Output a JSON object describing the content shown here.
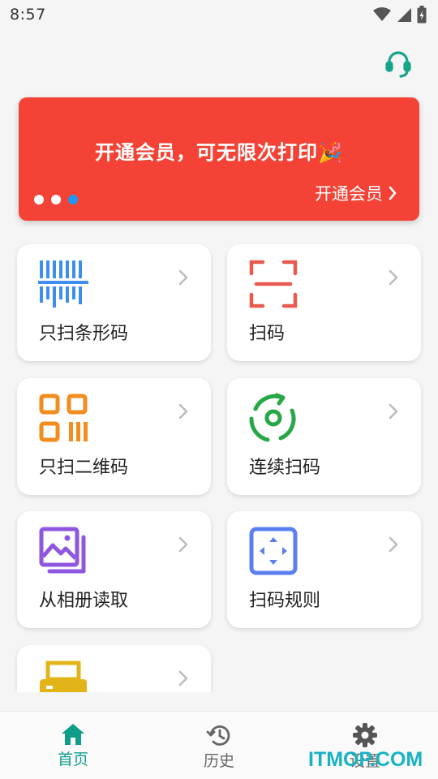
{
  "status_bar": {
    "time": "8:57",
    "icons": [
      "wifi-icon",
      "signal-icon",
      "battery-icon"
    ]
  },
  "header": {
    "support_icon": "headset-icon",
    "support_color": "#17a589"
  },
  "banner": {
    "title": "开通会员，可无限次打印🎉",
    "link_label": "开通会员",
    "background": "#f44336",
    "dots": 3,
    "active_dot": 3
  },
  "features": [
    {
      "label": "只扫条形码",
      "icon": "barcode-icon",
      "color": "#3d8ef0"
    },
    {
      "label": "扫码",
      "icon": "scan-frame-icon",
      "color": "#e85a4f"
    },
    {
      "label": "只扫二维码",
      "icon": "qr-code-icon",
      "color": "#f28c1c"
    },
    {
      "label": "连续扫码",
      "icon": "continuous-scan-icon",
      "color": "#27a745"
    },
    {
      "label": "从相册读取",
      "icon": "gallery-icon",
      "color": "#8f56e0"
    },
    {
      "label": "扫码规则",
      "icon": "scan-rules-icon",
      "color": "#5b7ff0"
    },
    {
      "label": "",
      "icon": "printer-icon",
      "color": "#e3b417"
    }
  ],
  "bottom_nav": {
    "items": [
      {
        "label": "首页",
        "icon": "home-icon",
        "active": true
      },
      {
        "label": "历史",
        "icon": "history-icon",
        "active": false
      },
      {
        "label": "设置",
        "icon": "settings-icon",
        "active": false
      }
    ],
    "active_color": "#0f9d8a",
    "inactive_color": "#666666"
  },
  "watermark": "ITMOP.COM"
}
